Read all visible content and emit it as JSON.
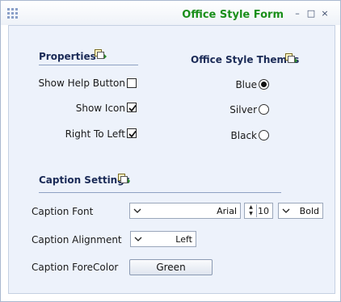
{
  "window": {
    "title": "Office Style Form",
    "system_icon": "grid-icon",
    "controls": {
      "minimize": "–",
      "maximize": "□",
      "close": "×"
    },
    "title_color": "#1a8f1a"
  },
  "properties": {
    "heading": "Properties",
    "icon": "smart-tag-icon",
    "show_help_button": {
      "label": "Show Help Button",
      "checked": false
    },
    "show_icon": {
      "label": "Show Icon",
      "checked": true
    },
    "right_to_left": {
      "label": "Right To Left",
      "checked": true
    }
  },
  "themes": {
    "heading": "Office Style Themes",
    "icon": "smart-tag-icon",
    "options": [
      {
        "label": "Blue",
        "selected": true
      },
      {
        "label": "Silver",
        "selected": false
      },
      {
        "label": "Black",
        "selected": false
      }
    ]
  },
  "caption": {
    "heading": "Caption Settings",
    "icon": "smart-tag-icon",
    "font_label": "Caption Font",
    "font_value": "Arial",
    "font_size": "10",
    "font_style": "Bold",
    "alignment_label": "Caption Alignment",
    "alignment_value": "Left",
    "forecolor_label": "Caption ForeColor",
    "forecolor_value": "Green"
  }
}
